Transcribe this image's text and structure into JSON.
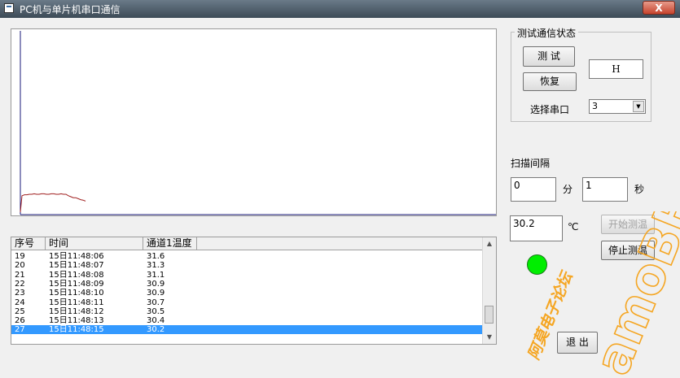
{
  "window": {
    "title": "PC机与单片机串口通信",
    "close_glyph": "X"
  },
  "chart_data": {
    "type": "line",
    "title": "",
    "xlabel": "",
    "ylabel": "",
    "series": [
      {
        "name": "",
        "values": [
          31.3,
          31.5,
          31.5,
          31.6,
          31.6,
          31.7,
          31.6,
          31.6,
          31.7,
          31.7,
          31.6,
          31.6,
          31.7,
          31.7,
          31.6,
          31.6,
          31.7,
          31.6,
          31.6,
          31.3,
          31.1,
          30.9,
          30.9,
          30.7,
          30.5,
          30.4,
          30.2
        ],
        "color": "#a02020"
      }
    ],
    "axis_color": "#1a1a7a",
    "grid": false
  },
  "table": {
    "columns": [
      "序号",
      "时间",
      "通道1温度"
    ],
    "rows": [
      [
        "19",
        "15日11:48:06",
        "31.6"
      ],
      [
        "20",
        "15日11:48:07",
        "31.3"
      ],
      [
        "21",
        "15日11:48:08",
        "31.1"
      ],
      [
        "22",
        "15日11:48:09",
        "30.9"
      ],
      [
        "23",
        "15日11:48:10",
        "30.9"
      ],
      [
        "24",
        "15日11:48:11",
        "30.7"
      ],
      [
        "25",
        "15日11:48:12",
        "30.5"
      ],
      [
        "26",
        "15日11:48:13",
        "30.4"
      ],
      [
        "27",
        "15日11:48:15",
        "30.2"
      ]
    ],
    "selected_index": 8
  },
  "comm_group": {
    "title": "测试通信状态",
    "test_label": "测 试",
    "restore_label": "恢复",
    "status_value": "H",
    "port_label": "选择串口",
    "port_value": "3"
  },
  "scan": {
    "title": "扫描间隔",
    "minutes_value": "0",
    "minutes_unit": "分",
    "seconds_value": "1",
    "seconds_unit": "秒"
  },
  "temperature": {
    "value": "30.2",
    "unit": "℃"
  },
  "buttons": {
    "start": "开始测温",
    "stop": "停止测温",
    "exit": "退 出"
  },
  "led_color": "#00ee00",
  "watermark": {
    "cn": "阿莫电子论坛",
    "en": "amoBBS",
    "color": "#f5a623"
  }
}
